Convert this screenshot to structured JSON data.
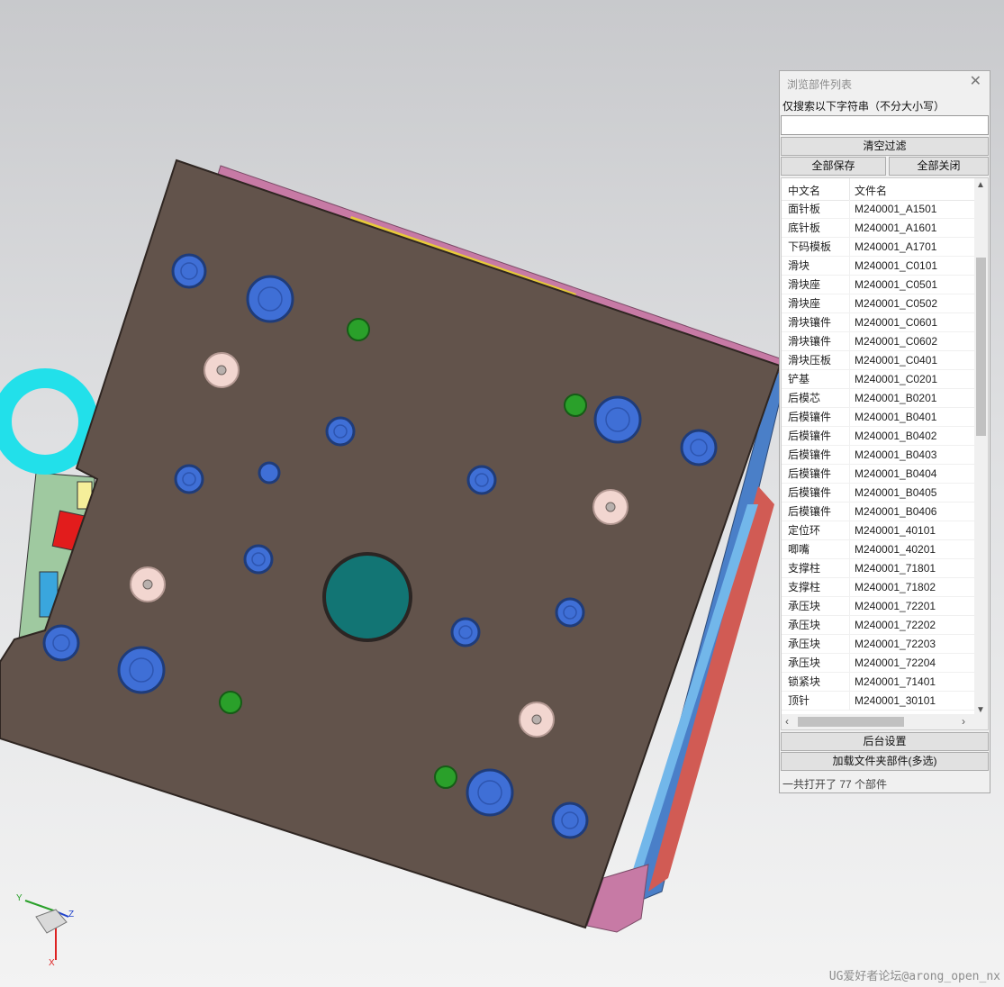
{
  "panel": {
    "title": "浏览部件列表",
    "search_label": "仅搜索以下字符串（不分大小写）",
    "search_value": "",
    "clear_filter": "清空过滤",
    "save_all": "全部保存",
    "close_all": "全部关闭",
    "columns": [
      "中文名",
      "文件名"
    ],
    "rows": [
      {
        "name": "面针板",
        "file": "M240001_A1501"
      },
      {
        "name": "底针板",
        "file": "M240001_A1601"
      },
      {
        "name": "下码模板",
        "file": "M240001_A1701"
      },
      {
        "name": "滑块",
        "file": "M240001_C0101"
      },
      {
        "name": "滑块座",
        "file": "M240001_C0501"
      },
      {
        "name": "滑块座",
        "file": "M240001_C0502"
      },
      {
        "name": "滑块镶件",
        "file": "M240001_C0601"
      },
      {
        "name": "滑块镶件",
        "file": "M240001_C0602"
      },
      {
        "name": "滑块压板",
        "file": "M240001_C0401"
      },
      {
        "name": "铲基",
        "file": "M240001_C0201"
      },
      {
        "name": "后模芯",
        "file": "M240001_B0201"
      },
      {
        "name": "后模镶件",
        "file": "M240001_B0401"
      },
      {
        "name": "后模镶件",
        "file": "M240001_B0402"
      },
      {
        "name": "后模镶件",
        "file": "M240001_B0403"
      },
      {
        "name": "后模镶件",
        "file": "M240001_B0404"
      },
      {
        "name": "后模镶件",
        "file": "M240001_B0405"
      },
      {
        "name": "后模镶件",
        "file": "M240001_B0406"
      },
      {
        "name": "定位环",
        "file": "M240001_40101"
      },
      {
        "name": "唧嘴",
        "file": "M240001_40201"
      },
      {
        "name": "支撑柱",
        "file": "M240001_71801"
      },
      {
        "name": "支撑柱",
        "file": "M240001_71802"
      },
      {
        "name": "承压块",
        "file": "M240001_72201"
      },
      {
        "name": "承压块",
        "file": "M240001_72202"
      },
      {
        "name": "承压块",
        "file": "M240001_72203"
      },
      {
        "name": "承压块",
        "file": "M240001_72204"
      },
      {
        "name": "锁紧块",
        "file": "M240001_71401"
      },
      {
        "name": "顶针",
        "file": "M240001_30101"
      }
    ],
    "background_settings": "后台设置",
    "load_folder": "加载文件夹部件(多选)",
    "status": "一共打开了 77 个部件"
  },
  "axes": {
    "y": "Y",
    "z": "Z",
    "x": "X"
  },
  "watermark": "UG爱好者论坛@arong_open_nx",
  "colors": {
    "plate": "#62534b",
    "bolt": "#3f6fd6",
    "green": "#2aa02a",
    "pink": "#f2d6d0",
    "cyan": "#22e0ea",
    "teal": "#127574"
  },
  "icons": [
    "close-icon",
    "scroll-up-icon",
    "scroll-down-icon",
    "scroll-left-icon",
    "scroll-right-icon"
  ]
}
